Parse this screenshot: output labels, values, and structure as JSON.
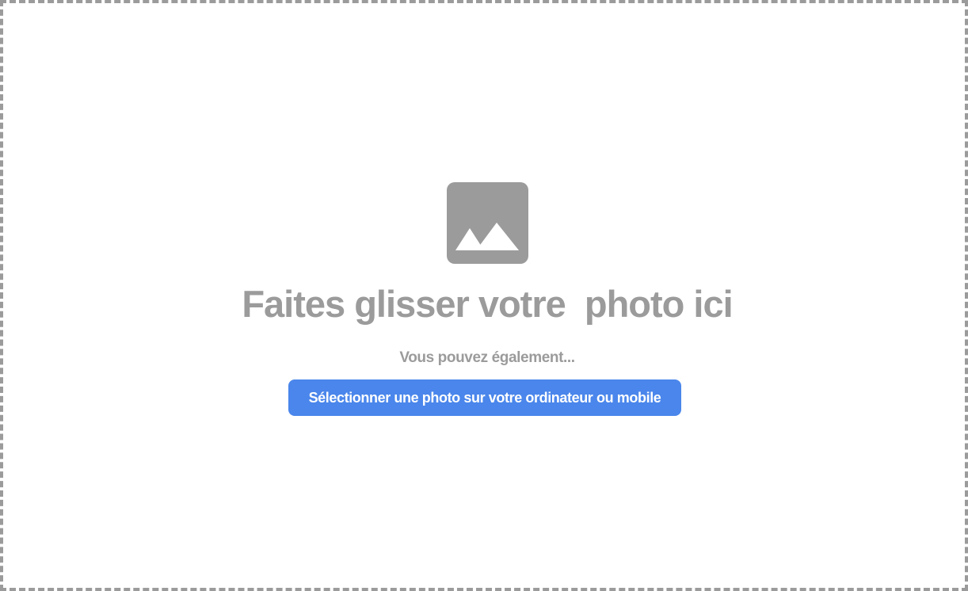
{
  "dropzone": {
    "icon": "image-mountains-icon",
    "title": "Faites glisser votre  photo ici",
    "subtitle": "Vous pouvez également...",
    "select_button_label": "Sélectionner une photo sur votre ordinateur ou mobile"
  },
  "colors": {
    "border": "#9b9b9b",
    "icon": "#9b9b9b",
    "text": "#9b9b9b",
    "button_bg": "#4a86eb",
    "button_text": "#ffffff",
    "background": "#ffffff"
  }
}
